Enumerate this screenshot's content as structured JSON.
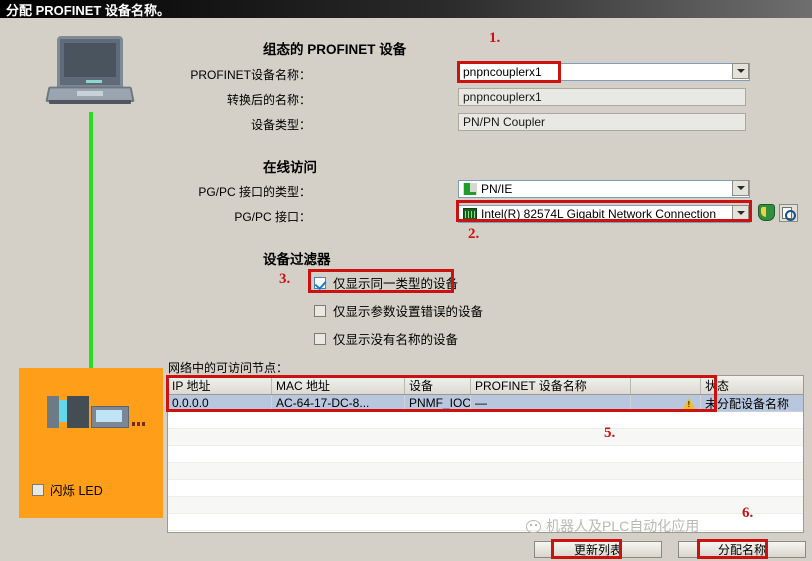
{
  "window": {
    "title": "分配 PROFINET 设备名称。"
  },
  "left_panel": {
    "blink_led_label": "闪烁 LED",
    "blink_led_checked": false,
    "panel_color": "#ff9e18",
    "cable_color": "#26e01c"
  },
  "configured_section": {
    "heading": "组态的 PROFINET 设备",
    "fields": [
      {
        "label": "PROFINET设备名称：",
        "value": "pnpncouplerx1",
        "type": "combobox",
        "highlighted": true
      },
      {
        "label": "转换后的名称：",
        "value": "pnpncouplerx1",
        "type": "readonly",
        "highlighted": false
      },
      {
        "label": "设备类型：",
        "value": "PN/PN Coupler",
        "type": "readonly",
        "highlighted": false
      }
    ]
  },
  "online_section": {
    "heading": "在线访问",
    "fields": [
      {
        "label": "PG/PC 接口的类型：",
        "value": "PN/IE",
        "icon": "network-plug-icon",
        "highlighted": false
      },
      {
        "label": "PG/PC 接口：",
        "value": "Intel(R) 82574L Gigabit Network Connection",
        "icon": "network-card-icon",
        "highlighted": true
      }
    ],
    "side_icons": [
      "shield-icon",
      "search-document-icon"
    ]
  },
  "filter_section": {
    "heading": "设备过滤器",
    "checkboxes": [
      {
        "label": "仅显示同一类型的设备",
        "checked": true,
        "highlighted": true
      },
      {
        "label": "仅显示参数设置错误的设备",
        "checked": false,
        "highlighted": false
      },
      {
        "label": "仅显示没有名称的设备",
        "checked": false,
        "highlighted": false
      }
    ]
  },
  "table": {
    "caption": "网络中的可访问节点：",
    "columns": [
      "IP 地址",
      "MAC 地址",
      "设备",
      "PROFINET 设备名称",
      "",
      "状态"
    ],
    "rows": [
      {
        "ip": "0.0.0.0",
        "mac": "AC-64-17-DC-8...",
        "device": "PNMF_IOC",
        "profinet_name": "—",
        "status_icon": "warning-icon",
        "status": "未分配设备名称"
      }
    ],
    "empty_row_count": 7
  },
  "buttons": {
    "update_list": "更新列表",
    "assign_name": "分配名称"
  },
  "annotations": {
    "markers": [
      "1.",
      "2.",
      "3.",
      "5.",
      "6."
    ],
    "color": "#cc1111"
  },
  "watermark": {
    "text": "机器人及PLC自动化应用"
  }
}
